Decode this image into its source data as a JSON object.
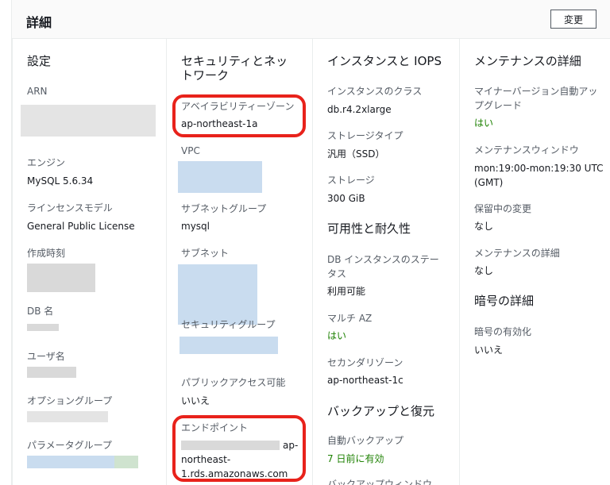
{
  "header": {
    "title": "詳細",
    "edit_label": "変更"
  },
  "col1": {
    "heading": "設定",
    "arn_label": "ARN",
    "engine_label": "エンジン",
    "engine_value": "MySQL 5.6.34",
    "license_label": "ラインセンスモデル",
    "license_value": "General Public License",
    "created_label": "作成時刻",
    "dbname_label": "DB 名",
    "user_label": "ユーザ名",
    "option_label": "オプショングループ",
    "param_label": "パラメータグループ"
  },
  "col2": {
    "heading_l1": "セキュリティとネッ",
    "heading_l2": "トワーク",
    "az_label": "アベイラビリティーゾーン",
    "az_value": "ap-northeast-1a",
    "vpc_label": "VPC",
    "subnet_group_label": "サブネットグループ",
    "subnet_group_value": "mysql",
    "subnet_label": "サブネット",
    "sg_label": "セキュリティグループ",
    "public_label": "パブリックアクセス可能",
    "public_value": "いいえ",
    "endpoint_label": "エンドポイント",
    "endpoint_l1": "ap-",
    "endpoint_l2": "northeast-",
    "endpoint_l3": "1.rds.amazonaws.com"
  },
  "col3": {
    "heading": "インスタンスと IOPS",
    "class_label": "インスタンスのクラス",
    "class_value": "db.r4.2xlarge",
    "storage_type_label": "ストレージタイプ",
    "storage_type_value": "汎用（SSD）",
    "storage_label": "ストレージ",
    "storage_value": "300 GiB",
    "avail_heading": "可用性と耐久性",
    "status_label_l1": "DB インスタンスのステー",
    "status_label_l2": "タス",
    "status_value": "利用可能",
    "multiaz_label": "マルチ AZ",
    "multiaz_value": "はい",
    "secondary_label": "セカンダリゾーン",
    "secondary_value": "ap-northeast-1c",
    "backup_heading": "バックアップと復元",
    "auto_backup_label": "自動バックアップ",
    "auto_backup_value": "7 日前に有効",
    "backup_window_label": "バックアップウィンドウ"
  },
  "col4": {
    "heading": "メンテナンスの詳細",
    "minor_label_l1": "マイナーバージョン自動アッ",
    "minor_label_l2": "プグレード",
    "minor_value": "はい",
    "window_label": "メンテナンスウィンドウ",
    "window_value_l1": "mon:19:00-mon:19:30 UTC",
    "window_value_l2": "(GMT)",
    "pending_label": "保留中の変更",
    "pending_value": "なし",
    "maint_details_label": "メンテナンスの詳細",
    "maint_details_value": "なし",
    "enc_heading": "暗号の詳細",
    "enc_label": "暗号の有効化",
    "enc_value": "いいえ"
  },
  "colors": {
    "highlight": "#e8221b",
    "enabled_green": "#1d8102"
  }
}
